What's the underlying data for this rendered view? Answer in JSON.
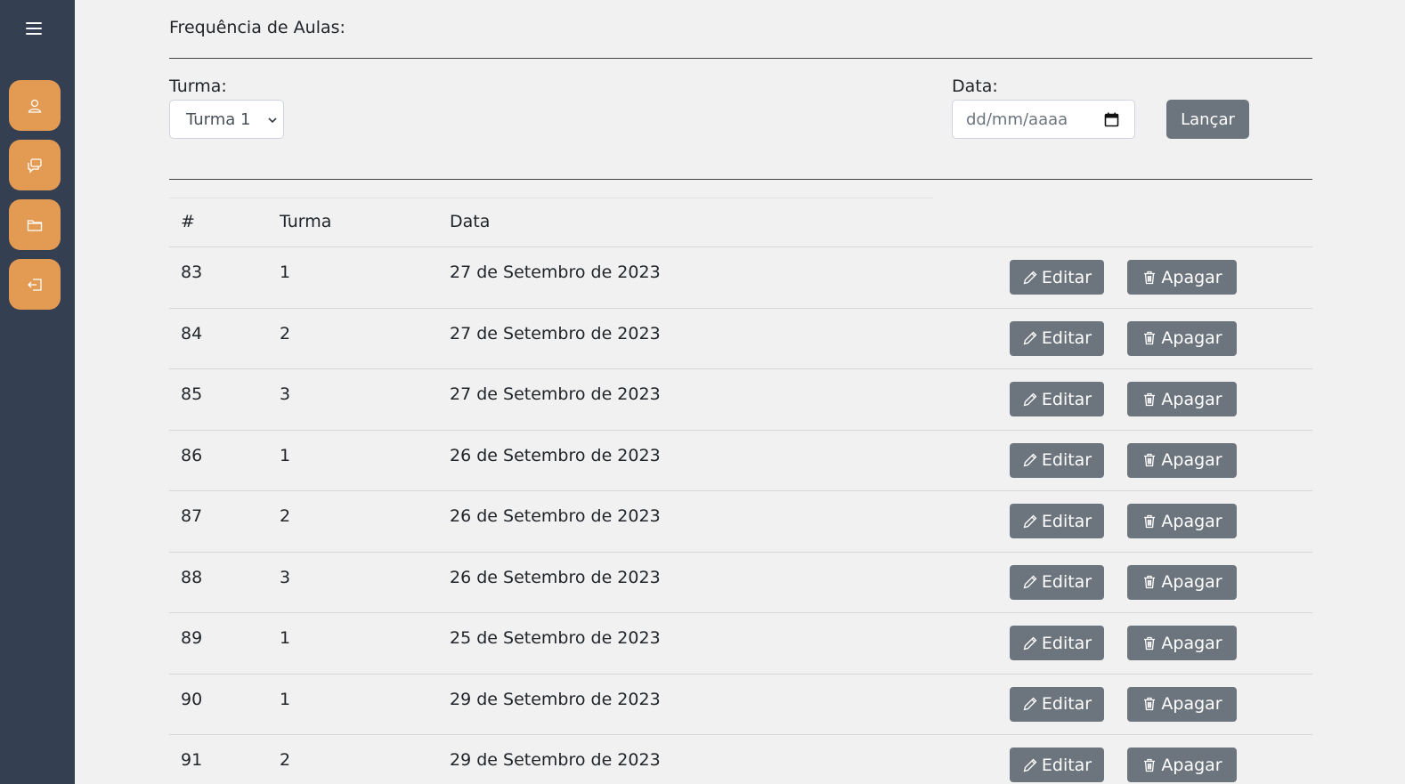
{
  "sidebar": {
    "menu_icon": "hamburger-menu-icon",
    "items": [
      {
        "icon": "person-icon"
      },
      {
        "icon": "chat-bubbles-icon"
      },
      {
        "icon": "folder-icon"
      },
      {
        "icon": "logout-icon"
      }
    ],
    "colors": {
      "background": "#343f52",
      "accent": "#e39a52"
    }
  },
  "page": {
    "title": "Frequência de Aulas:"
  },
  "form": {
    "turma_label": "Turma:",
    "turma_selected": "Turma 1",
    "data_label": "Data:",
    "data_placeholder": "dd/mm/aaaa",
    "launch_label": "Lançar"
  },
  "table": {
    "headers": [
      "#",
      "Turma",
      "Data"
    ],
    "rows": [
      {
        "id": "83",
        "turma": "1",
        "data": "27 de Setembro de 2023"
      },
      {
        "id": "84",
        "turma": "2",
        "data": "27 de Setembro de 2023"
      },
      {
        "id": "85",
        "turma": "3",
        "data": "27 de Setembro de 2023"
      },
      {
        "id": "86",
        "turma": "1",
        "data": "26 de Setembro de 2023"
      },
      {
        "id": "87",
        "turma": "2",
        "data": "26 de Setembro de 2023"
      },
      {
        "id": "88",
        "turma": "3",
        "data": "26 de Setembro de 2023"
      },
      {
        "id": "89",
        "turma": "1",
        "data": "25 de Setembro de 2023"
      },
      {
        "id": "90",
        "turma": "1",
        "data": "29 de Setembro de 2023"
      },
      {
        "id": "91",
        "turma": "2",
        "data": "29 de Setembro de 2023"
      }
    ],
    "edit_label": "Editar",
    "delete_label": "Apagar",
    "button_color": "#6c757d"
  }
}
